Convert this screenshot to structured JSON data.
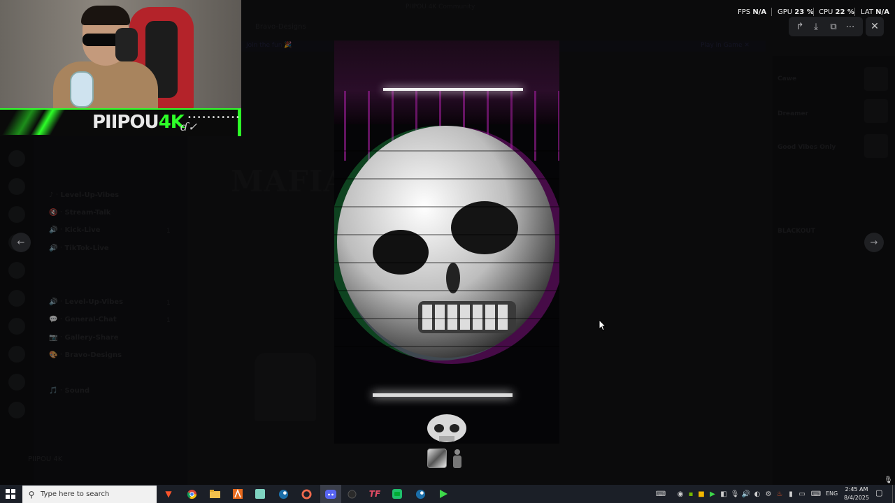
{
  "window": {
    "title": "PIIPOU 4K Community"
  },
  "background": {
    "header_title": "Bravo-Designs",
    "announcement_left": "Join the fun 🎉",
    "announcement_right": "Play in Game ✕",
    "server_banner": "MAFIA",
    "channels": [
      {
        "label": "♪ ᐧ Level-Up-Vibes",
        "badge": ""
      },
      {
        "label": "🔇 ᐧ Stream-Talk",
        "badge": ""
      },
      {
        "label": "🔊 ᐧ Kick-Live",
        "badge": "1"
      },
      {
        "label": "🔊 ᐧ TikTok-Live",
        "badge": ""
      },
      {
        "label": "🔊 ᐧ Level-Up-Vibes",
        "badge": "1"
      },
      {
        "label": "💬 ᐧ General-Chat",
        "badge": "1"
      },
      {
        "label": "📷 ᐧ Gallery-Share",
        "badge": ""
      },
      {
        "label": "🎨 ᐧ Bravo-Designs",
        "badge": ""
      },
      {
        "label": "🎵 ᐧ Sound",
        "badge": ""
      }
    ],
    "user": "PIIPOU 4K",
    "members": [
      {
        "name": "Cawe"
      },
      {
        "name": "Dreamer"
      },
      {
        "name": "Good Vibes Only"
      },
      {
        "name": "BLACKOUT"
      }
    ]
  },
  "webcam": {
    "name_prefix": "PIIPOU",
    "name_accent": "4K",
    "dots": "••••••••••••",
    "signature": "ɗ✓"
  },
  "viewer": {
    "toolbar": {
      "forward_icon": "forward-icon",
      "download_icon": "download-icon",
      "open_external_icon": "open-external-icon",
      "more_icon": "more-icon",
      "close_icon": "close-icon"
    },
    "prev_icon": "arrow-left-icon",
    "next_icon": "arrow-right-icon"
  },
  "hud": {
    "fps_label": "FPS",
    "fps_value": "N/A",
    "gpu_label": "GPU",
    "gpu_value": "23 %",
    "cpu_label": "CPU",
    "cpu_value": "22 %",
    "lat_label": "LAT",
    "lat_value": "N/A"
  },
  "taskbar": {
    "search_placeholder": "Type here to search",
    "lang": "ENG",
    "time": "2:45 AM",
    "date": "8/4/2025"
  },
  "colors": {
    "accent_green": "#2dff28",
    "glitch_magenta": "#c018c0",
    "glitch_green": "#2aff6a",
    "taskbar_bg": "#1b1f27"
  }
}
